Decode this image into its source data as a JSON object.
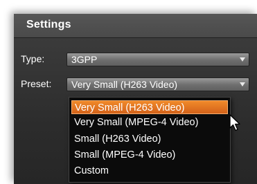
{
  "panel": {
    "title": "Settings"
  },
  "type_row": {
    "label": "Type:",
    "value": "3GPP"
  },
  "preset_row": {
    "label": "Preset:",
    "value": "Very Small (H263 Video)"
  },
  "dropdown": {
    "options": [
      "Very Small (H263 Video)",
      "Very Small (MPEG-4 Video)",
      "Small (H263 Video)",
      "Small (MPEG-4 Video)",
      "Custom"
    ],
    "highlighted_index": 0
  },
  "colors": {
    "panel_bg": "#2f2f2f",
    "header_bg": "#4a4a4a",
    "highlight": "#e8731f",
    "dropdown_bg": "#0b0b0b"
  },
  "icons": {
    "select_arrow": "chevron-down-icon",
    "cursor": "mouse-pointer-icon"
  }
}
